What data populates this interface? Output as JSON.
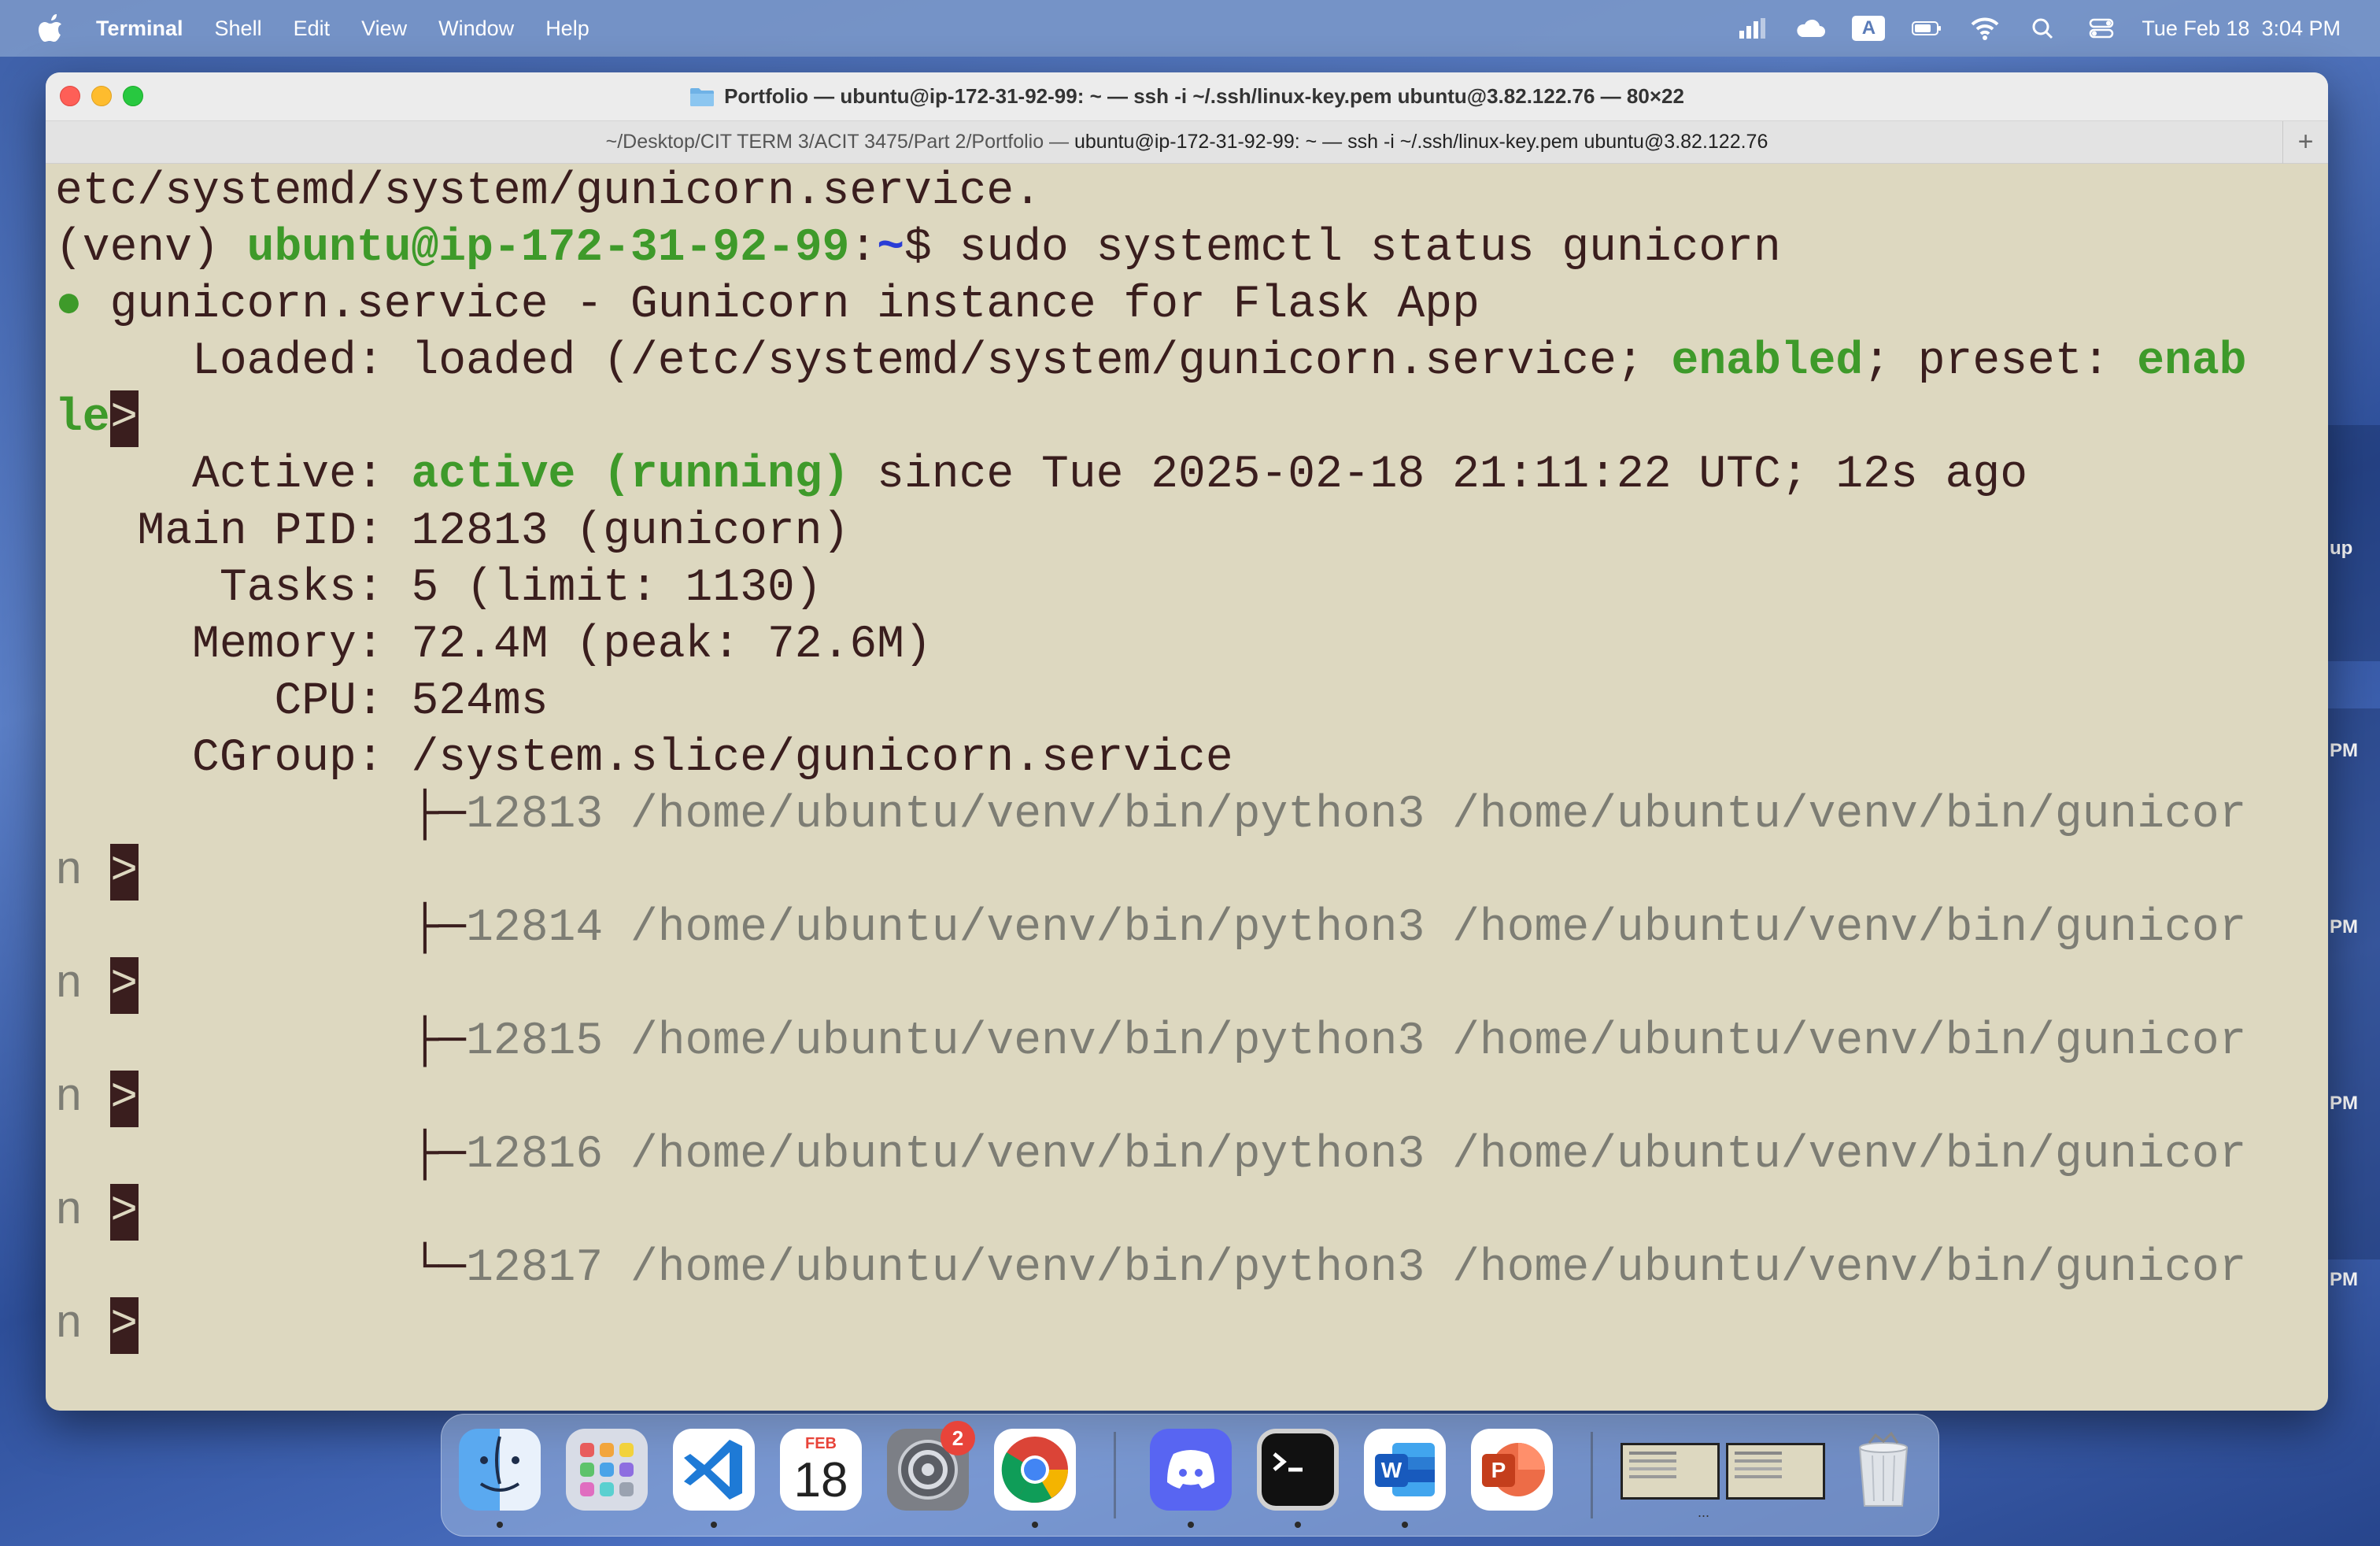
{
  "menubar": {
    "app_name": "Terminal",
    "items": [
      "Shell",
      "Edit",
      "View",
      "Window",
      "Help"
    ],
    "input_badge": "A",
    "clock": "Tue Feb 18  3:04 PM"
  },
  "desktop_fragments": [
    "up",
    "PM",
    "PM",
    "PM",
    "PM"
  ],
  "window": {
    "title": "Portfolio — ubuntu@ip-172-31-92-99: ~ — ssh -i ~/.ssh/linux-key.pem ubuntu@3.82.122.76 — 80×22",
    "tab_path": "~/Desktop/CIT TERM 3/ACIT 3475/Part 2/Portfolio — ",
    "tab_session": "ubuntu@ip-172-31-92-99: ~ — ssh -i ~/.ssh/linux-key.pem ubuntu@3.82.122.76",
    "new_tab": "+"
  },
  "terminal": {
    "line0": "etc/systemd/system/gunicorn.service.",
    "prompt_venv": "(venv) ",
    "prompt_user": "ubuntu@ip-172-31-92-99",
    "prompt_colon": ":",
    "prompt_path": "~",
    "prompt_dollar": "$ ",
    "command": "sudo systemctl status gunicorn",
    "status_dot": "●",
    "service_line": " gunicorn.service - Gunicorn instance for Flask App",
    "loaded_prefix": "     Loaded: loaded (/etc/systemd/system/gunicorn.service; ",
    "loaded_enabled": "enabled",
    "loaded_mid": "; preset: ",
    "loaded_wrap_a": "enab",
    "loaded_wrap_b": "le",
    "trunc_marker": ">",
    "active_prefix": "     Active: ",
    "active_state": "active (running)",
    "active_suffix": " since Tue 2025-02-18 21:11:22 UTC; 12s ago",
    "main_pid": "   Main PID: 12813 (gunicorn)",
    "tasks": "      Tasks: 5 (limit: 1130)",
    "memory": "     Memory: 72.4M (peak: 72.6M)",
    "cpu": "        CPU: 524ms",
    "cgroup": "     CGroup: /system.slice/gunicorn.service",
    "processes": [
      {
        "branch": "             ├─",
        "text": "12813 /home/ubuntu/venv/bin/python3 /home/ubuntu/venv/bin/gunicor"
      },
      {
        "branch": "             ├─",
        "text": "12814 /home/ubuntu/venv/bin/python3 /home/ubuntu/venv/bin/gunicor"
      },
      {
        "branch": "             ├─",
        "text": "12815 /home/ubuntu/venv/bin/python3 /home/ubuntu/venv/bin/gunicor"
      },
      {
        "branch": "             ├─",
        "text": "12816 /home/ubuntu/venv/bin/python3 /home/ubuntu/venv/bin/gunicor"
      },
      {
        "branch": "             └─",
        "text": "12817 /home/ubuntu/venv/bin/python3 /home/ubuntu/venv/bin/gunicor"
      }
    ],
    "process_wrap": "n "
  },
  "dock": {
    "calendar_month": "FEB",
    "calendar_day": "18",
    "settings_badge": "2",
    "thumb_more": "..."
  }
}
